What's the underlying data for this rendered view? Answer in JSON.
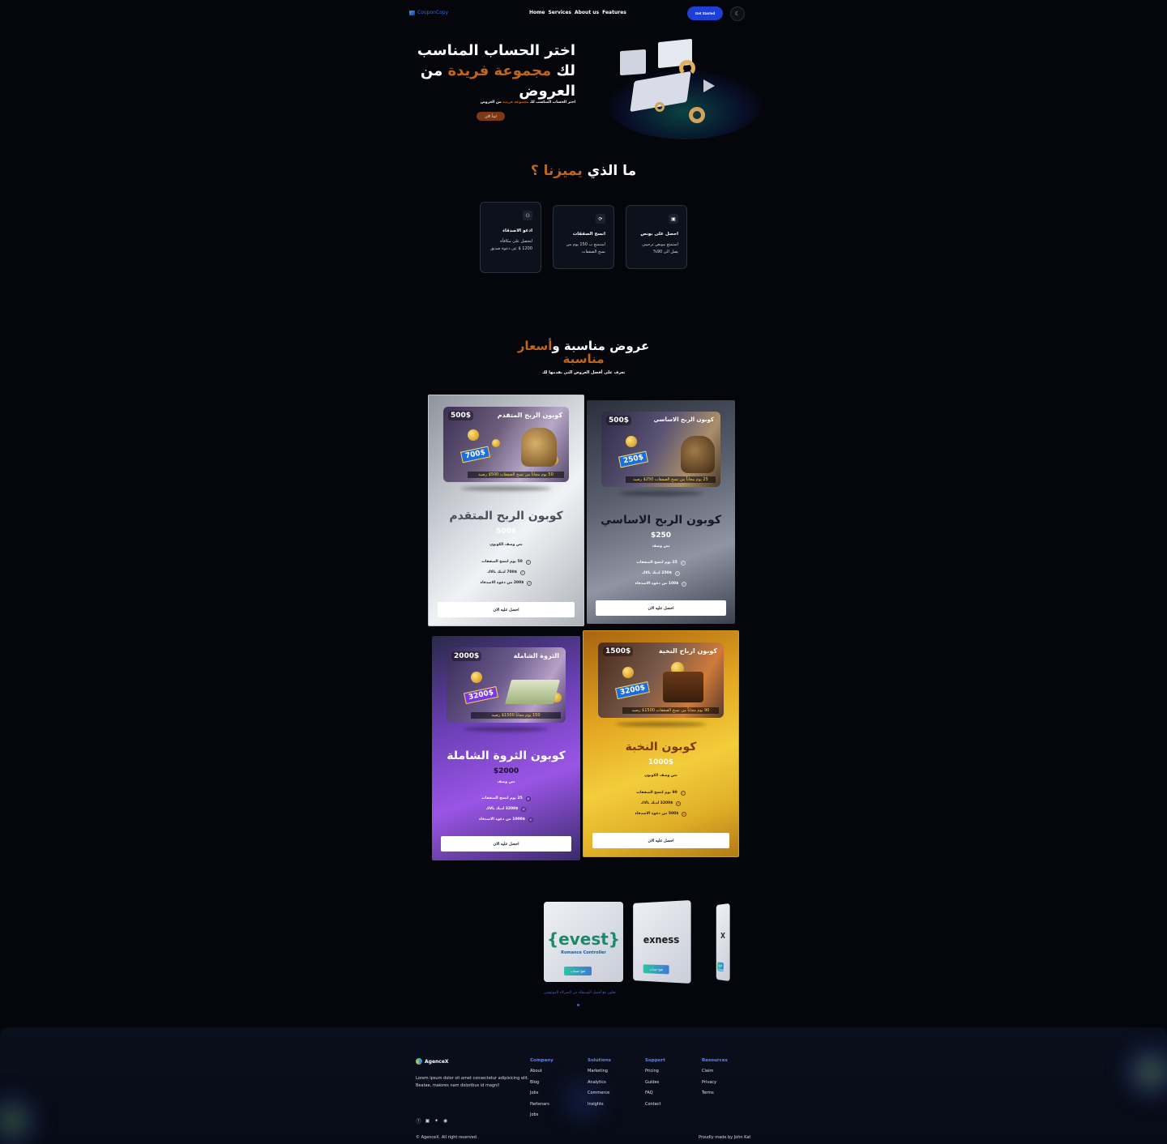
{
  "nav": {
    "logo": "CouponCopy",
    "links": [
      "Home",
      "Services",
      "About us",
      "Features"
    ],
    "cta": "Get Started",
    "theme_icon": "moon-icon"
  },
  "hero": {
    "title_line1": "اختر الحساب المناسب",
    "title_line2_a": "لك ",
    "title_line2_accent": "مجموعة فريدة",
    "title_line2_b": " من",
    "title_line3": "العروض",
    "subtitle_a": "اختر الحساب المناسب لك ",
    "subtitle_accent": "مجموعة فريدة",
    "subtitle_b": " من العروض",
    "cta": "ابدأ الان"
  },
  "features_section": {
    "title_a": "ما الذي ",
    "title_accent": "يميزنا ؟",
    "cards": [
      {
        "icon": "gift-icon",
        "title": "احصل على بونص",
        "desc": "استمتع ببونص ترحيبي يصل الى 90%"
      },
      {
        "icon": "copy-icon",
        "title": "انسخ الصفقات",
        "desc": "استمتع ب 150 يوم من نسخ الصفقات"
      },
      {
        "icon": "users-icon",
        "title": "ادعو الاصدقاء",
        "desc": "لتحصل على مكافأة 1200 $ عن دعوة صديق"
      }
    ]
  },
  "offers_section": {
    "title_a": "عروض مناسبة و",
    "title_accent": "أسعار مناسبة",
    "subtitle": "تعرف على أفضل العروض التي نقدمها لك",
    "cards": [
      {
        "image_title": "كوبون الربح المتقدم",
        "image_badge": "500$",
        "image_tag": "700$",
        "image_strip": "50 يوم مجاناً من نسخ الصفقات  500$ رصيد",
        "name": "كوبون الربح المتقدم",
        "price": "500$",
        "desc": "نص وصف الكوبون",
        "features": [
          "50 يوم لنسخ الصفقات",
          "700$ لديك بالاك",
          "200$ من دعوة الاصدقاء"
        ],
        "cta": "احصل عليه الان"
      },
      {
        "image_title": "كوبون الربح الاساسي",
        "image_badge": "500$",
        "image_tag": "250$",
        "image_strip": "25 يوم مجاناً من نسخ الصفقات  250$ رصيد",
        "name": "كوبون الربح الاساسي",
        "price": "$250",
        "desc": "نص وصف",
        "features": [
          "25 يوم لنسخ الصفقات",
          "250$ لديك بالاك",
          "100$ من دعوة الاصدقاء"
        ],
        "cta": "احصل عليه الان"
      },
      {
        "image_title": "الثروة الشاملة",
        "image_badge": "2000$",
        "image_tag": "3200$",
        "image_strip": "150 يوم مجاناً  1500$ رصيد",
        "name": "كوبون الثروة الشاملة",
        "price": "$2000",
        "desc": "نص وصف",
        "features": [
          "25 يوم لنسخ الصفقات",
          "3200$ لديك بالاك",
          "1000$ من دعوة الاصدقاء"
        ],
        "cta": "احصل عليه الان"
      },
      {
        "image_title": "كوبون ارباح النخبة",
        "image_badge": "1500$",
        "image_tag": "3200$",
        "image_strip": "90 يوم مجاناً من نسخ الصفقات  1500$ رصيد",
        "name": "كوبون النخبة",
        "price": "1000$",
        "desc": "نص وصف الكوبون",
        "features": [
          "90 يوم لنسخ الصفقات",
          "3200$ لديك بالاك",
          "500$ من دعوة الاصدقاء"
        ],
        "cta": "احصل عليه الان"
      }
    ]
  },
  "partners": {
    "items": [
      {
        "logo_a": "{evest}",
        "logo_b": "Romance Controller",
        "cta": "فتح حساب"
      },
      {
        "logo_a": "exness",
        "logo_b": "",
        "cta": "فتح حساب"
      },
      {
        "logo_a": "X",
        "logo_b": "",
        "cta": "فتح حساب"
      }
    ],
    "caption": "تعاون مع أفضل الوسطاء من الشركاء الموثوقين"
  },
  "footer": {
    "brand": "AgenceX",
    "text": "Lorem ipsum dolor sit amet consectetur adipisicing elit. Beatae, maiores nam doloribus id magni!",
    "social": [
      "facebook-icon",
      "linkedin-icon",
      "twitter-icon",
      "github-icon"
    ],
    "copyright": "© AgenceX. All right reserved",
    "made_by": "Proudly made by John Kat",
    "columns": [
      {
        "title": "Company",
        "items": [
          "About",
          "Blog",
          "Jobs",
          "Partenars",
          "Jobs"
        ]
      },
      {
        "title": "Solutions",
        "items": [
          "Marketing",
          "Analytics",
          "Commerce",
          "Insights"
        ]
      },
      {
        "title": "Support",
        "items": [
          "Pricing",
          "Guides",
          "FAQ",
          "Contact"
        ]
      },
      {
        "title": "Resources",
        "items": [
          "Claim",
          "Privacy",
          "Terms"
        ]
      }
    ]
  }
}
